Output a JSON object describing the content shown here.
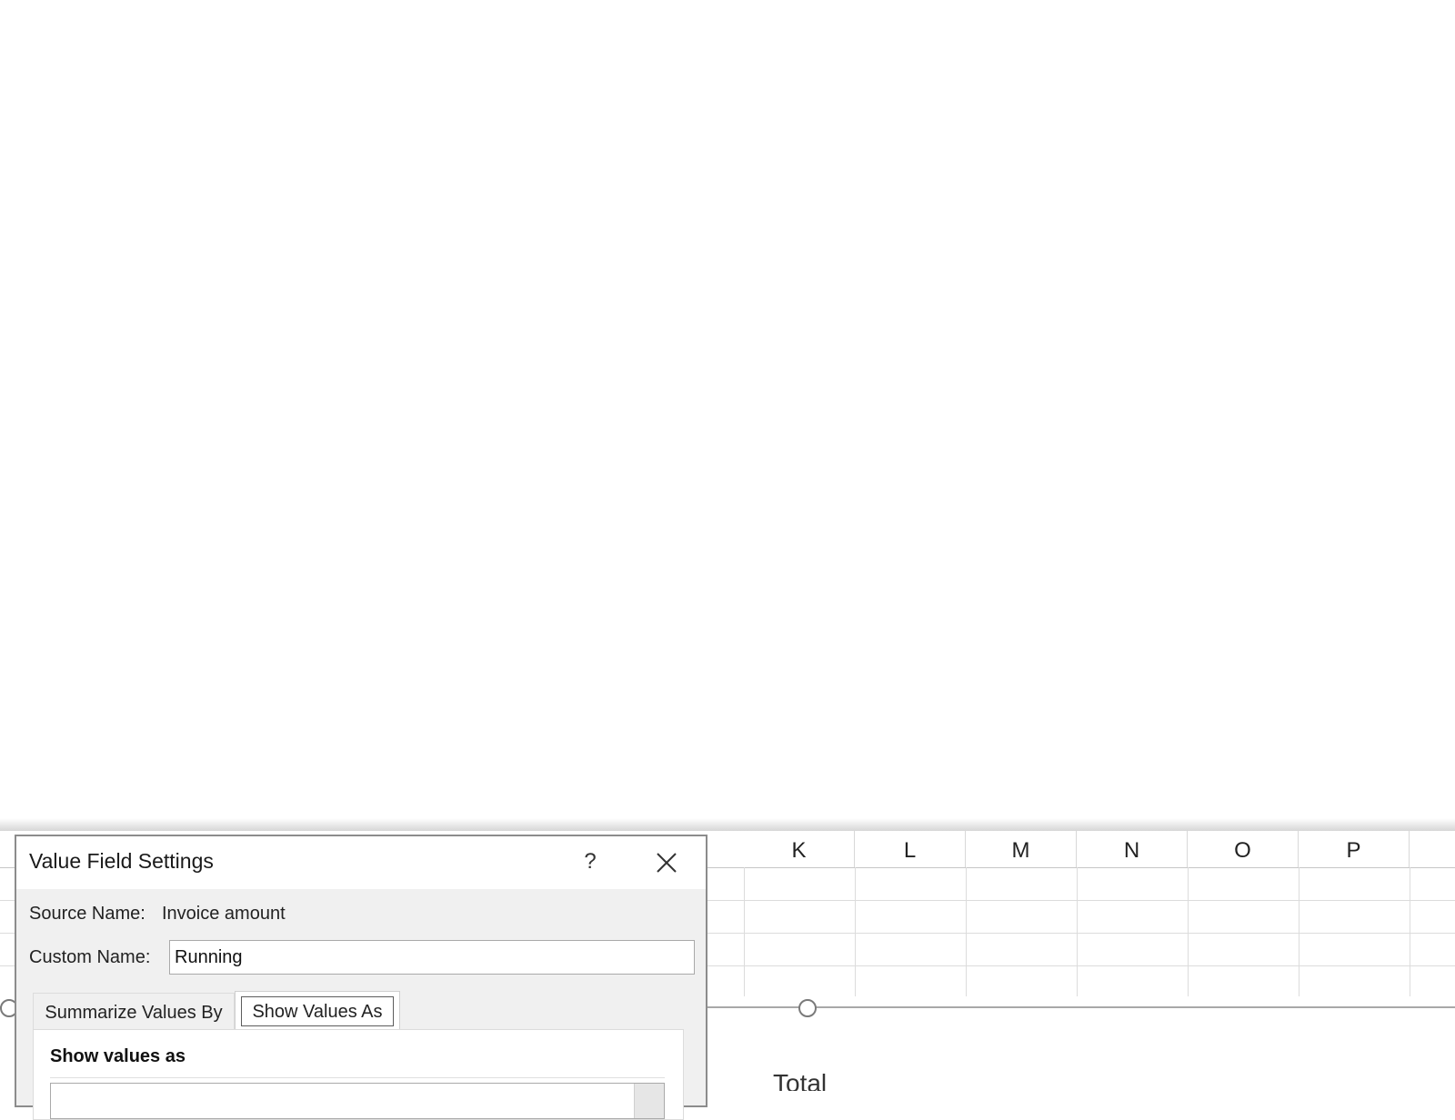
{
  "spreadsheet": {
    "columns": [
      "K",
      "L",
      "M",
      "N",
      "O",
      "P"
    ],
    "partial_text": "Total"
  },
  "dialog": {
    "title": "Value Field Settings",
    "help_label": "?",
    "source_name_label": "Source Name:",
    "source_name_value": "Invoice amount",
    "custom_name_label": "Custom Name:",
    "custom_name_value": "Running",
    "tabs": [
      {
        "label": "Summarize Values By",
        "active": false
      },
      {
        "label": "Show Values As",
        "active": true
      }
    ],
    "section_title": "Show values as"
  }
}
